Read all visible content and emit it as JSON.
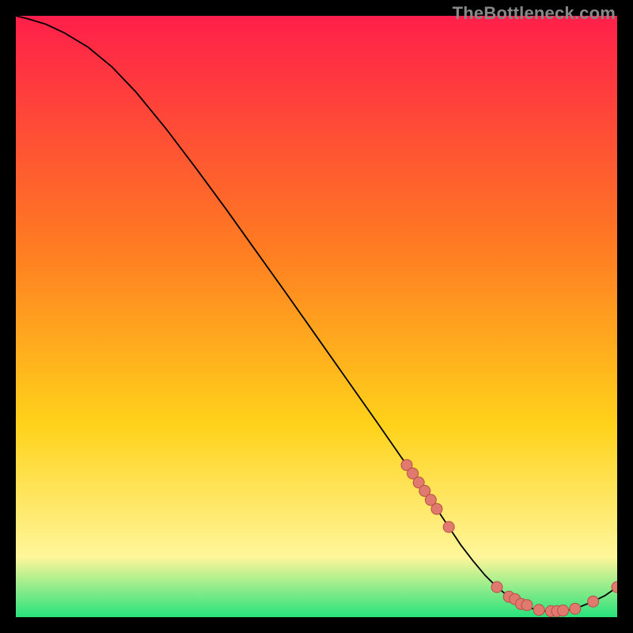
{
  "attribution": "TheBottleneck.com",
  "colors": {
    "top": "#ff1f4a",
    "mid1": "#ff7a22",
    "mid2": "#ffd21a",
    "low": "#fff69a",
    "bottom": "#27e27b",
    "background": "#000000",
    "curve": "#000000",
    "marker_fill": "#e07a6e",
    "marker_stroke": "#b84f45",
    "attribution_text": "#888888"
  },
  "chart_data": {
    "type": "line",
    "title": "",
    "xlabel": "",
    "ylabel": "",
    "xlim": [
      0,
      100
    ],
    "ylim": [
      0,
      100
    ],
    "grid": false,
    "legend": false,
    "background": "red-yellow-green vertical gradient",
    "x": [
      0,
      2,
      5,
      8,
      12,
      16,
      20,
      25,
      30,
      35,
      40,
      45,
      50,
      55,
      60,
      65,
      68,
      70,
      72,
      74,
      76,
      78,
      80,
      82,
      84,
      86,
      88,
      90,
      92,
      94,
      96,
      98,
      100
    ],
    "values": [
      100,
      99.5,
      98.6,
      97.2,
      94.8,
      91.5,
      87.3,
      81.2,
      74.6,
      67.8,
      60.8,
      53.8,
      46.7,
      39.6,
      32.5,
      25.3,
      21.0,
      18.0,
      15.0,
      12.0,
      9.4,
      7.0,
      5.0,
      3.4,
      2.2,
      1.4,
      1.0,
      1.0,
      1.2,
      1.8,
      2.6,
      3.6,
      5.0
    ],
    "markers": {
      "x": [
        65,
        66,
        67,
        68,
        69,
        70,
        72,
        80,
        82,
        83,
        84,
        85,
        87,
        89,
        90,
        91,
        93,
        96,
        100
      ],
      "y": [
        25.3,
        23.9,
        22.4,
        21.0,
        19.5,
        18.0,
        15.0,
        5.0,
        3.4,
        3.0,
        2.2,
        2.0,
        1.2,
        1.0,
        1.0,
        1.1,
        1.4,
        2.6,
        5.0
      ]
    }
  }
}
